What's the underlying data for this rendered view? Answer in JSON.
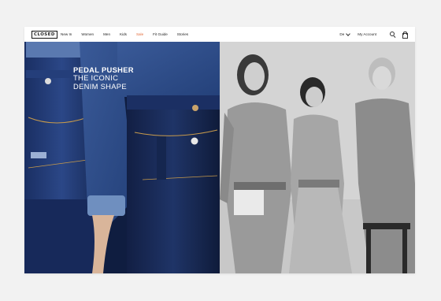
{
  "brand": {
    "logo": "CLOSED"
  },
  "nav": {
    "links": [
      "New In",
      "Women",
      "Men",
      "Kids",
      "Sale",
      "Fit Guide",
      "Stories"
    ],
    "language": "De",
    "account": "My Account"
  },
  "icons": {
    "search": "search-icon",
    "bag": "shopping-bag-icon",
    "language_dropdown": "chevron-down-icon"
  },
  "colors": {
    "sale": "#e36b3a",
    "denim_dark": "#0e1f45",
    "text": "#222222"
  },
  "hero": {
    "line1": "PEDAL PUSHER",
    "line2": "THE ICONIC",
    "line3": "DENIM SHAPE"
  }
}
